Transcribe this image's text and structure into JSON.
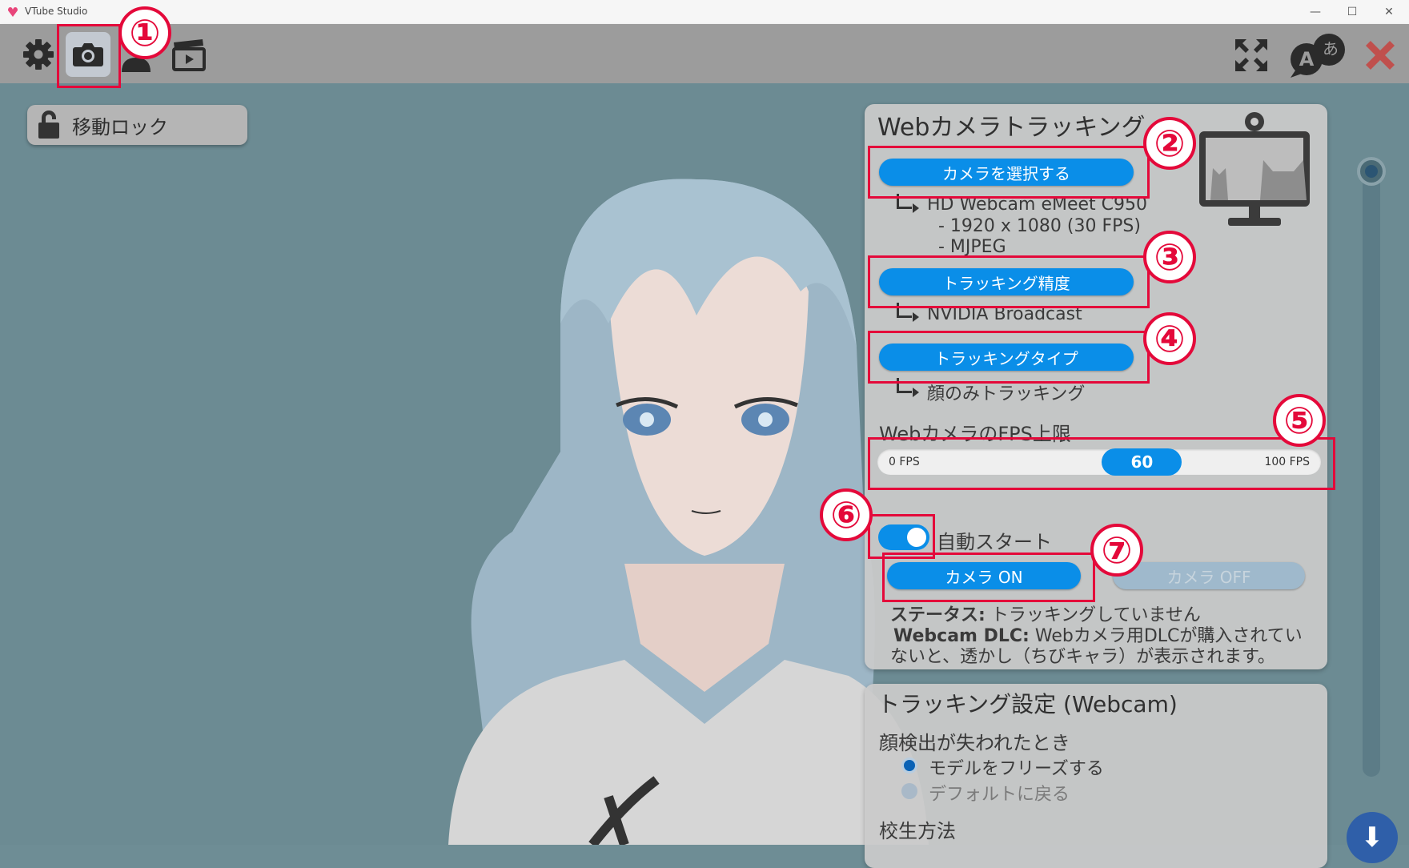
{
  "window": {
    "title": "VTube Studio",
    "controls": [
      "—",
      "☐",
      "✕"
    ]
  },
  "toolbar": {
    "left_icons": [
      "gear-icon",
      "camera-icon",
      "person-icon",
      "clapperboard-icon"
    ],
    "right_icons": [
      "expand-icon",
      "language-icon",
      "close-icon"
    ],
    "language_glyphs": {
      "a": "A",
      "b": "あ"
    }
  },
  "lock_button": {
    "label": "移動ロック"
  },
  "webcam_panel": {
    "title": "Webカメラトラッキング",
    "select_camera_label": "カメラを選択する",
    "camera_name": "HD Webcam eMeet C950",
    "resolution": "- 1920 x 1080 (30 FPS)",
    "format": "- MJPEG",
    "precision_label": "トラッキング精度",
    "precision_value": "NVIDIA Broadcast",
    "type_label": "トラッキングタイプ",
    "type_value": "顔のみトラッキング",
    "fps_title": "WebカメラのFPS上限",
    "fps_min_label": "0 FPS",
    "fps_max_label": "100 FPS",
    "fps_value": "60",
    "fps_fraction": 0.6,
    "autostart_label": "自動スタート",
    "autostart_on": true,
    "camera_on_label": "カメラ ON",
    "camera_off_label": "カメラ OFF",
    "status_key": "ステータス:",
    "status_value": "トラッキングしていません",
    "dlc_key": "Webcam DLC:",
    "dlc_line1": "Webカメラ用DLCが購入されてい",
    "dlc_line2": "ないと、透かし（ちびキャラ）が表示されます。"
  },
  "tracking_panel": {
    "title": "トラッキング設定 (Webcam)",
    "lost_title": "顔検出が失われたとき",
    "option_freeze": "モデルをフリーズする",
    "option_default": "デフォルトに戻る",
    "calibration_title": "校生方法"
  },
  "badges": [
    "①",
    "②",
    "③",
    "④",
    "⑤",
    "⑥",
    "⑦"
  ],
  "colors": {
    "accent": "#0a8ee8",
    "highlight": "#e4093a",
    "stage": "#6c8b93"
  }
}
